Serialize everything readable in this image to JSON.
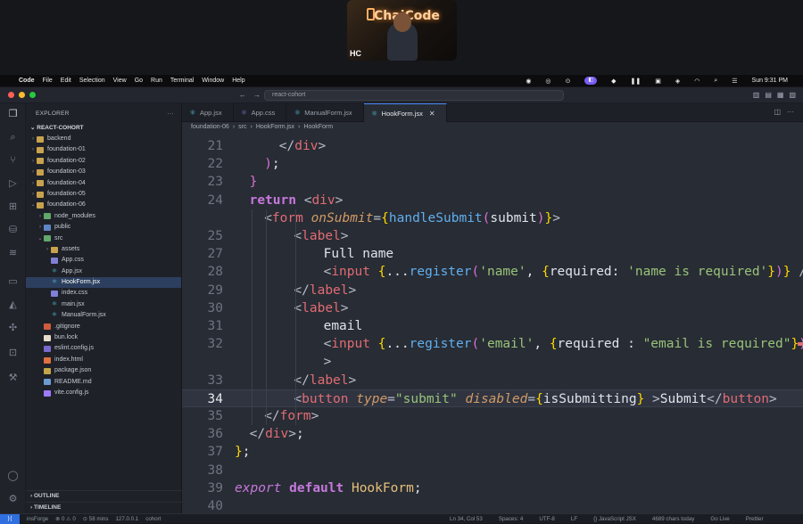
{
  "webcam": {
    "brand": "ChaiCode",
    "initials": "HC"
  },
  "menubar": {
    "app": "Code",
    "items": [
      "File",
      "Edit",
      "Selection",
      "View",
      "Go",
      "Run",
      "Terminal",
      "Window",
      "Help"
    ],
    "clock": "Sun 9:31 PM"
  },
  "titlebar": {
    "search": "react-cohort"
  },
  "explorer": {
    "title": "EXPLORER",
    "root": "REACT-COHORT",
    "items": [
      {
        "label": "backend",
        "depth": 1,
        "kind": "folder",
        "chev": "›"
      },
      {
        "label": "foundation-01",
        "depth": 1,
        "kind": "folder",
        "chev": "›"
      },
      {
        "label": "foundation-02",
        "depth": 1,
        "kind": "folder",
        "chev": "›"
      },
      {
        "label": "foundation-03",
        "depth": 1,
        "kind": "folder",
        "chev": "›"
      },
      {
        "label": "foundation-04",
        "depth": 1,
        "kind": "folder",
        "chev": "›"
      },
      {
        "label": "foundation-05",
        "depth": 1,
        "kind": "folder",
        "chev": "›"
      },
      {
        "label": "foundation-06",
        "depth": 1,
        "kind": "folder",
        "chev": "⌄"
      },
      {
        "label": "node_modules",
        "depth": 2,
        "kind": "folder green",
        "chev": "›"
      },
      {
        "label": "public",
        "depth": 2,
        "kind": "folder blue",
        "chev": "›"
      },
      {
        "label": "src",
        "depth": 2,
        "kind": "folder green",
        "chev": "⌄"
      },
      {
        "label": "assets",
        "depth": 3,
        "kind": "folder",
        "chev": "›"
      },
      {
        "label": "App.css",
        "depth": 3,
        "kind": "css",
        "chev": ""
      },
      {
        "label": "App.jsx",
        "depth": 3,
        "kind": "react",
        "chev": ""
      },
      {
        "label": "HookForm.jsx",
        "depth": 3,
        "kind": "react",
        "chev": "",
        "selected": true
      },
      {
        "label": "index.css",
        "depth": 3,
        "kind": "css",
        "chev": ""
      },
      {
        "label": "main.jsx",
        "depth": 3,
        "kind": "react",
        "chev": ""
      },
      {
        "label": "ManualForm.jsx",
        "depth": 3,
        "kind": "react",
        "chev": ""
      },
      {
        "label": ".gitignore",
        "depth": 2,
        "kind": "git",
        "chev": ""
      },
      {
        "label": "bun.lock",
        "depth": 2,
        "kind": "bun",
        "chev": ""
      },
      {
        "label": "eslint.config.js",
        "depth": 2,
        "kind": "eslint",
        "chev": ""
      },
      {
        "label": "index.html",
        "depth": 2,
        "kind": "html",
        "chev": ""
      },
      {
        "label": "package.json",
        "depth": 2,
        "kind": "json",
        "chev": ""
      },
      {
        "label": "README.md",
        "depth": 2,
        "kind": "md",
        "chev": ""
      },
      {
        "label": "vite.config.js",
        "depth": 2,
        "kind": "vite",
        "chev": ""
      }
    ],
    "outline": "OUTLINE",
    "timeline": "TIMELINE"
  },
  "tabs": [
    {
      "label": "App.jsx",
      "active": false
    },
    {
      "label": "App.css",
      "active": false
    },
    {
      "label": "ManualForm.jsx",
      "active": false
    },
    {
      "label": "HookForm.jsx",
      "active": true
    }
  ],
  "breadcrumb": [
    "foundation-06",
    "src",
    "HookForm.jsx",
    "HookForm"
  ],
  "editor": {
    "current_line": "34",
    "lines": [
      {
        "n": "21",
        "indent": 3,
        "tokens": [
          [
            "c-brk",
            "</"
          ],
          [
            "c-tag",
            "div"
          ],
          [
            "c-brk",
            ">"
          ]
        ]
      },
      {
        "n": "22",
        "indent": 2,
        "tokens": [
          [
            "c-b2",
            ")"
          ],
          [
            "c-plain",
            ";"
          ]
        ]
      },
      {
        "n": "23",
        "indent": 1,
        "tokens": [
          [
            "c-b2",
            "}"
          ]
        ]
      },
      {
        "n": "24",
        "indent": 1,
        "tokens": [
          [
            "c-kw",
            "return"
          ],
          [
            "c-plain",
            " "
          ],
          [
            "c-brk",
            "<"
          ],
          [
            "c-tag",
            "div"
          ],
          [
            "c-brk",
            ">"
          ]
        ]
      },
      {
        "n": "",
        "indent": 2,
        "tokens": [
          [
            "c-brk",
            "<"
          ],
          [
            "c-tag",
            "form"
          ],
          [
            "c-plain",
            " "
          ],
          [
            "c-attr",
            "onSubmit"
          ],
          [
            "c-brk",
            "="
          ],
          [
            "c-b1",
            "{"
          ],
          [
            "c-fn",
            "handleSubmit"
          ],
          [
            "c-b2",
            "("
          ],
          [
            "c-plain",
            "submit"
          ],
          [
            "c-b2",
            ")"
          ],
          [
            "c-b1",
            "}"
          ],
          [
            "c-brk",
            ">"
          ]
        ]
      },
      {
        "n": "25",
        "indent": 4,
        "tokens": [
          [
            "c-brk",
            "<"
          ],
          [
            "c-tag",
            "label"
          ],
          [
            "c-brk",
            ">"
          ]
        ]
      },
      {
        "n": "27",
        "indent": 6,
        "tokens": [
          [
            "c-plain",
            "Full name"
          ]
        ]
      },
      {
        "n": "28",
        "indent": 6,
        "tokens": [
          [
            "c-brk",
            "<"
          ],
          [
            "c-tag",
            "input"
          ],
          [
            "c-plain",
            " "
          ],
          [
            "c-b1",
            "{"
          ],
          [
            "c-plain",
            "..."
          ],
          [
            "c-fn",
            "register"
          ],
          [
            "c-b2",
            "("
          ],
          [
            "c-str",
            "'name'"
          ],
          [
            "c-plain",
            ", "
          ],
          [
            "c-b1",
            "{"
          ],
          [
            "c-plain",
            "required: "
          ],
          [
            "c-str",
            "'name is required'"
          ],
          [
            "c-b1",
            "}"
          ],
          [
            "c-b2",
            ")"
          ],
          [
            "c-b1",
            "}"
          ],
          [
            "c-plain",
            " "
          ],
          [
            "c-brk",
            "/>"
          ]
        ]
      },
      {
        "n": "29",
        "indent": 4,
        "tokens": [
          [
            "c-brk",
            "</"
          ],
          [
            "c-tag",
            "label"
          ],
          [
            "c-brk",
            ">"
          ]
        ]
      },
      {
        "n": "30",
        "indent": 4,
        "tokens": [
          [
            "c-brk",
            "<"
          ],
          [
            "c-tag",
            "label"
          ],
          [
            "c-brk",
            ">"
          ]
        ]
      },
      {
        "n": "31",
        "indent": 6,
        "tokens": [
          [
            "c-plain",
            "email"
          ]
        ]
      },
      {
        "n": "32",
        "indent": 6,
        "tokens": [
          [
            "c-brk",
            "<"
          ],
          [
            "c-tag",
            "input"
          ],
          [
            "c-plain",
            " "
          ],
          [
            "c-b1",
            "{"
          ],
          [
            "c-plain",
            "..."
          ],
          [
            "c-fn",
            "register"
          ],
          [
            "c-b2",
            "("
          ],
          [
            "c-str",
            "'email'"
          ],
          [
            "c-plain",
            ", "
          ],
          [
            "c-b1",
            "{"
          ],
          [
            "c-plain",
            "required : "
          ],
          [
            "c-str",
            "\"email is required\""
          ],
          [
            "c-b1",
            "}"
          ],
          [
            "c-b2",
            ")"
          ],
          [
            "c-b1",
            "}"
          ],
          [
            "c-plain",
            " "
          ],
          [
            "c-brk",
            "/"
          ]
        ]
      },
      {
        "n": "",
        "indent": 6,
        "tokens": [
          [
            "c-brk",
            ">"
          ]
        ]
      },
      {
        "n": "33",
        "indent": 4,
        "tokens": [
          [
            "c-brk",
            "</"
          ],
          [
            "c-tag",
            "label"
          ],
          [
            "c-brk",
            ">"
          ]
        ]
      },
      {
        "n": "34",
        "indent": 4,
        "tokens": [
          [
            "c-brk",
            "<"
          ],
          [
            "c-tag",
            "button"
          ],
          [
            "c-plain",
            " "
          ],
          [
            "c-attr",
            "type"
          ],
          [
            "c-brk",
            "="
          ],
          [
            "c-str",
            "\"submit\""
          ],
          [
            "c-plain",
            " "
          ],
          [
            "c-attr",
            "disabled"
          ],
          [
            "c-brk",
            "="
          ],
          [
            "c-b1",
            "{"
          ],
          [
            "c-plain",
            "isSubmitting"
          ],
          [
            "c-b1",
            "}"
          ],
          [
            "c-plain",
            " "
          ],
          [
            "c-brk",
            ">"
          ],
          [
            "c-plain",
            "Submit"
          ],
          [
            "c-brk",
            "</"
          ],
          [
            "c-tag",
            "button"
          ],
          [
            "c-brk",
            ">"
          ]
        ]
      },
      {
        "n": "35",
        "indent": 2,
        "tokens": [
          [
            "c-brk",
            "</"
          ],
          [
            "c-tag",
            "form"
          ],
          [
            "c-brk",
            ">"
          ]
        ]
      },
      {
        "n": "36",
        "indent": 1,
        "tokens": [
          [
            "c-brk",
            "</"
          ],
          [
            "c-tag",
            "div"
          ],
          [
            "c-brk",
            ">"
          ],
          [
            "c-plain",
            ";"
          ]
        ]
      },
      {
        "n": "37",
        "indent": 0,
        "tokens": [
          [
            "c-b1",
            "}"
          ],
          [
            "c-plain",
            ";"
          ]
        ]
      },
      {
        "n": "38",
        "indent": 0,
        "tokens": []
      },
      {
        "n": "39",
        "indent": 0,
        "tokens": [
          [
            "c-kwi",
            "export"
          ],
          [
            "c-plain",
            " "
          ],
          [
            "c-kw",
            "default"
          ],
          [
            "c-plain",
            " "
          ],
          [
            "c-id",
            "HookForm"
          ],
          [
            "c-plain",
            ";"
          ]
        ]
      },
      {
        "n": "40",
        "indent": 0,
        "tokens": []
      }
    ]
  },
  "statusbar": {
    "left": [
      "insForge",
      "⊗ 0 ⚠ 0",
      "⊙ 58 mins",
      "127.0.0.1",
      "cohort"
    ],
    "right": [
      "Ln 34, Col 53",
      "Spaces: 4",
      "UTF-8",
      "LF",
      "{} JavaScript JSX",
      "4689 chars today",
      "Go Live",
      "Prettier"
    ]
  }
}
